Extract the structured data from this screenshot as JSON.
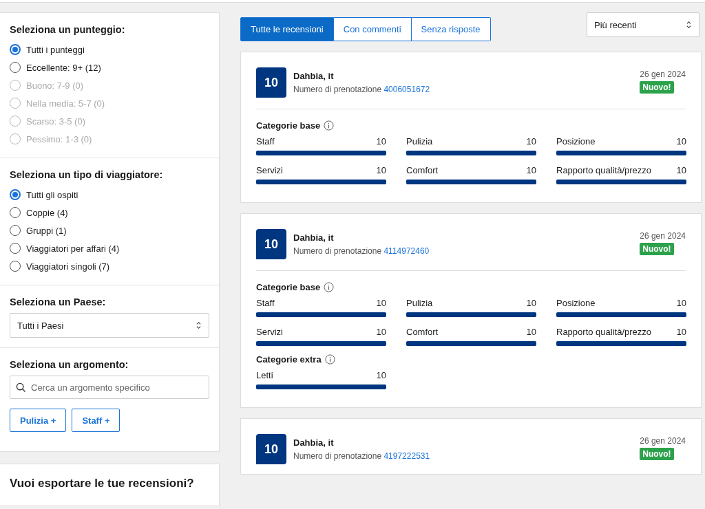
{
  "filters": {
    "score": {
      "title": "Seleziona un punteggio:",
      "options": [
        {
          "label": "Tutti i punteggi",
          "selected": true,
          "disabled": false
        },
        {
          "label": "Eccellente: 9+ (12)",
          "selected": false,
          "disabled": false
        },
        {
          "label": "Buono: 7-9 (0)",
          "selected": false,
          "disabled": true
        },
        {
          "label": "Nella media: 5-7 (0)",
          "selected": false,
          "disabled": true
        },
        {
          "label": "Scarso: 3-5 (0)",
          "selected": false,
          "disabled": true
        },
        {
          "label": "Pessimo: 1-3 (0)",
          "selected": false,
          "disabled": true
        }
      ]
    },
    "traveler": {
      "title": "Seleziona un tipo di viaggiatore:",
      "options": [
        {
          "label": "Tutti gli ospiti",
          "selected": true,
          "disabled": false
        },
        {
          "label": "Coppie (4)",
          "selected": false,
          "disabled": false
        },
        {
          "label": "Gruppi (1)",
          "selected": false,
          "disabled": false
        },
        {
          "label": "Viaggiatori per affari (4)",
          "selected": false,
          "disabled": false
        },
        {
          "label": "Viaggiatori singoli (7)",
          "selected": false,
          "disabled": false
        }
      ]
    },
    "country": {
      "title": "Seleziona un Paese:",
      "value": "Tutti i Paesi"
    },
    "topic": {
      "title": "Seleziona un argomento:",
      "placeholder": "Cerca un argomento specifico",
      "chips": [
        "Pulizia +",
        "Staff +"
      ]
    }
  },
  "export": {
    "title": "Vuoi esportare le tue recensioni?"
  },
  "tabs": [
    {
      "label": "Tutte le recensioni",
      "selected": true
    },
    {
      "label": "Con commenti",
      "selected": false
    },
    {
      "label": "Senza risposte",
      "selected": false
    }
  ],
  "sort": {
    "value": "Più recenti"
  },
  "reviews": [
    {
      "score": "10",
      "name": "Dahbia, it",
      "booking_label": "Numero di prenotazione",
      "booking_number": "4006051672",
      "date": "26 gen 2024",
      "badge": "Nuovo!",
      "groups": [
        {
          "title": "Categorie base",
          "items": [
            {
              "name": "Staff",
              "value": "10",
              "level": 1
            },
            {
              "name": "Pulizia",
              "value": "10",
              "level": 1
            },
            {
              "name": "Posizione",
              "value": "10",
              "level": 1
            },
            {
              "name": "Servizi",
              "value": "10",
              "level": 1
            },
            {
              "name": "Comfort",
              "value": "10",
              "level": 1
            },
            {
              "name": "Rapporto qualità/prezzo",
              "value": "10",
              "level": 1
            }
          ]
        }
      ]
    },
    {
      "score": "10",
      "name": "Dahbia, it",
      "booking_label": "Numero di prenotazione",
      "booking_number": "4114972460",
      "date": "26 gen 2024",
      "badge": "Nuovo!",
      "groups": [
        {
          "title": "Categorie base",
          "items": [
            {
              "name": "Staff",
              "value": "10",
              "level": 1
            },
            {
              "name": "Pulizia",
              "value": "10",
              "level": 1
            },
            {
              "name": "Posizione",
              "value": "10",
              "level": 1
            },
            {
              "name": "Servizi",
              "value": "10",
              "level": 1
            },
            {
              "name": "Comfort",
              "value": "10",
              "level": 1
            },
            {
              "name": "Rapporto qualità/prezzo",
              "value": "10",
              "level": 1
            }
          ]
        },
        {
          "title": "Categorie extra",
          "items": [
            {
              "name": "Letti",
              "value": "10",
              "level": 1
            }
          ]
        }
      ]
    },
    {
      "score": "10",
      "name": "Dahbia, it",
      "booking_label": "Numero di prenotazione",
      "booking_number": "4197222531",
      "date": "26 gen 2024",
      "badge": "Nuovo!"
    }
  ]
}
